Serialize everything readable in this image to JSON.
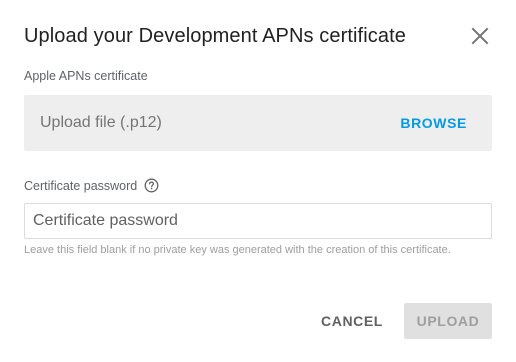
{
  "dialog": {
    "title": "Upload your Development APNs certificate",
    "close_icon": "close-icon"
  },
  "apns": {
    "label": "Apple APNs certificate",
    "upload_placeholder": "Upload file (.p12)",
    "browse_label": "BROWSE"
  },
  "password": {
    "label": "Certificate password",
    "help_icon": "help-circle-icon",
    "placeholder": "Certificate password",
    "value": "",
    "hint": "Leave this field blank if no private key was generated with the creation of this certificate."
  },
  "actions": {
    "cancel_label": "CANCEL",
    "upload_label": "UPLOAD",
    "upload_disabled": true
  },
  "colors": {
    "accent": "#039be5",
    "upload_box_bg": "#eeeeee",
    "disabled_button_bg": "#e0e0e0"
  }
}
